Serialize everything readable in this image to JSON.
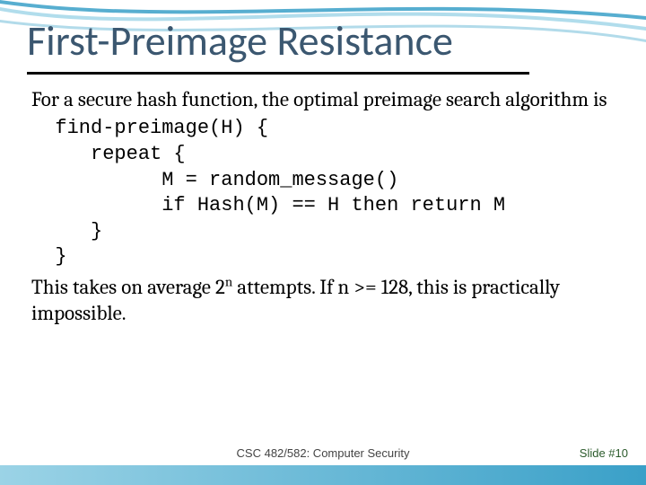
{
  "title": "First-Preimage Resistance",
  "body": {
    "intro": "For a secure hash function, the optimal preimage search algorithm is",
    "code_line1": "find-preimage(H) {",
    "code_line2": "   repeat {",
    "code_line3": "         M = random_message()",
    "code_line4": "         if Hash(M) == H then return M",
    "code_line5": "   }",
    "code_line6": "}",
    "conclusion_a": "This takes on average 2",
    "conclusion_exp": "n",
    "conclusion_b": " attempts. If n >= 128, this is practically impossible."
  },
  "footer": {
    "course": "CSC 482/582: Computer Security",
    "slide": "Slide #10"
  }
}
